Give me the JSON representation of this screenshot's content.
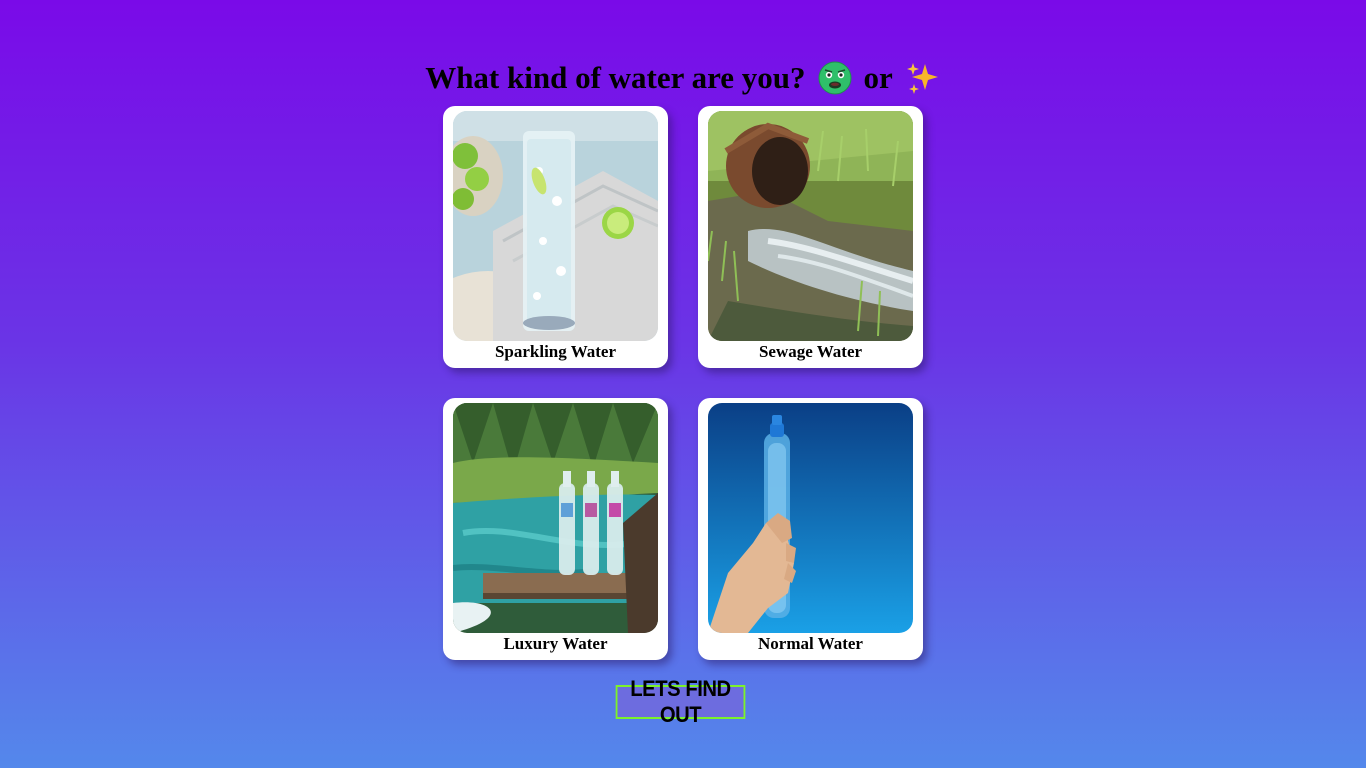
{
  "header": {
    "title_text": "What kind of water are you?",
    "connector": "or",
    "sick_icon": "nauseated-face-icon",
    "sparkle_icon": "sparkles-icon"
  },
  "cards": [
    {
      "label": "Sparkling Water",
      "image": "sparkling-water-glass-photo"
    },
    {
      "label": "Sewage Water",
      "image": "sewage-pipe-photo"
    },
    {
      "label": "Luxury Water",
      "image": "luxury-bottles-lake-photo"
    },
    {
      "label": "Normal Water",
      "image": "hand-holding-bottle-photo"
    }
  ],
  "cta": {
    "label": "LETS FIND OUT"
  },
  "colors": {
    "background_top": "#7a0ae8",
    "background_bottom": "#5488eb",
    "cta_border": "#7cf22c",
    "cta_fill": "#6d6cdf",
    "card": "#ffffff"
  }
}
